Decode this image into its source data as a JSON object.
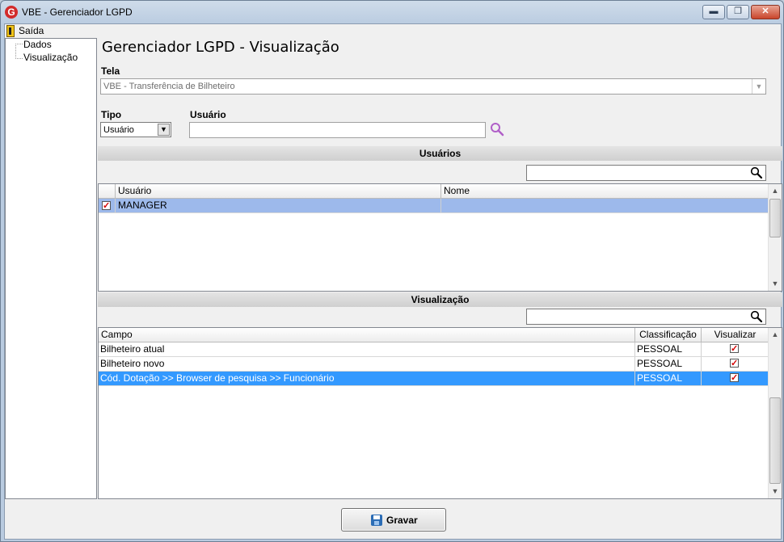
{
  "window": {
    "title": "VBE - Gerenciador LGPD",
    "icon_letter": "G",
    "buttons": {
      "minimize": "▬",
      "maximize": "❐",
      "close": "✕"
    }
  },
  "menu": {
    "exit_label": "Saída"
  },
  "tree": {
    "items": [
      "Dados",
      "Visualização"
    ]
  },
  "page": {
    "title": "Gerenciador LGPD - Visualização"
  },
  "form": {
    "tela_label": "Tela",
    "tela_value": "VBE - Transferência de Bilheteiro",
    "tipo_label": "Tipo",
    "tipo_value": "Usuário",
    "usuario_label": "Usuário",
    "usuario_value": ""
  },
  "usuarios": {
    "section_title": "Usuários",
    "search_value": "",
    "columns": [
      "Usuário",
      "Nome"
    ],
    "rows": [
      {
        "checked": true,
        "usuario": "MANAGER",
        "nome": ""
      }
    ]
  },
  "visualizacao": {
    "section_title": "Visualização",
    "search_value": "",
    "columns": [
      "Campo",
      "Classificação",
      "Visualizar"
    ],
    "rows": [
      {
        "campo": "Bilheteiro atual",
        "classificacao": "PESSOAL",
        "visualizar": true
      },
      {
        "campo": "Bilheteiro novo",
        "classificacao": "PESSOAL",
        "visualizar": true
      },
      {
        "campo": "Cód. Dotação >> Browser de pesquisa >> Funcionário",
        "classificacao": "PESSOAL",
        "visualizar": true
      }
    ]
  },
  "footer": {
    "save_label": "Gravar"
  },
  "icons": {
    "search": "search-icon",
    "magnifier": "magnifier-icon",
    "save": "save-icon",
    "exit": "exit-door-icon"
  }
}
